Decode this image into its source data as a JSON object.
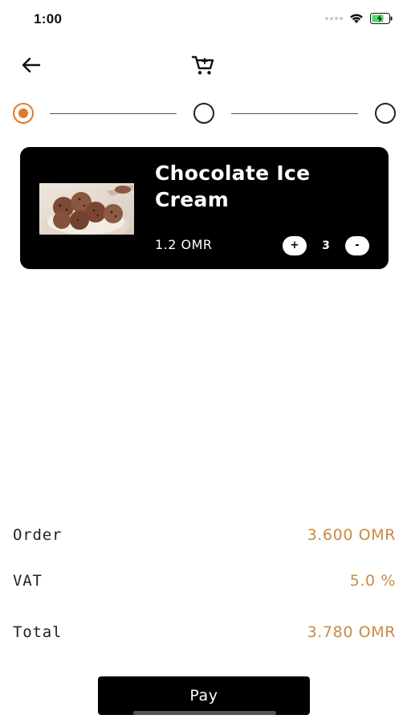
{
  "status_bar": {
    "time": "1:00"
  },
  "product": {
    "name": "Chocolate Ice Cream",
    "price": "1.2 OMR",
    "quantity": "3",
    "increment_label": "+",
    "decrement_label": "-"
  },
  "summary": {
    "order_label": "Order",
    "order_value": "3.600 OMR",
    "vat_label": "VAT",
    "vat_value": "5.0 %",
    "total_label": "Total",
    "total_value": "3.780 OMR"
  },
  "pay_label": "Pay",
  "stepper": {
    "active_step": 1,
    "steps": 3
  },
  "colors": {
    "accent": "#e07a2b",
    "value_text": "#c98a45",
    "card": "#000000"
  },
  "icons": [
    "back-arrow-icon",
    "cart-icon",
    "wifi-icon",
    "battery-icon"
  ]
}
